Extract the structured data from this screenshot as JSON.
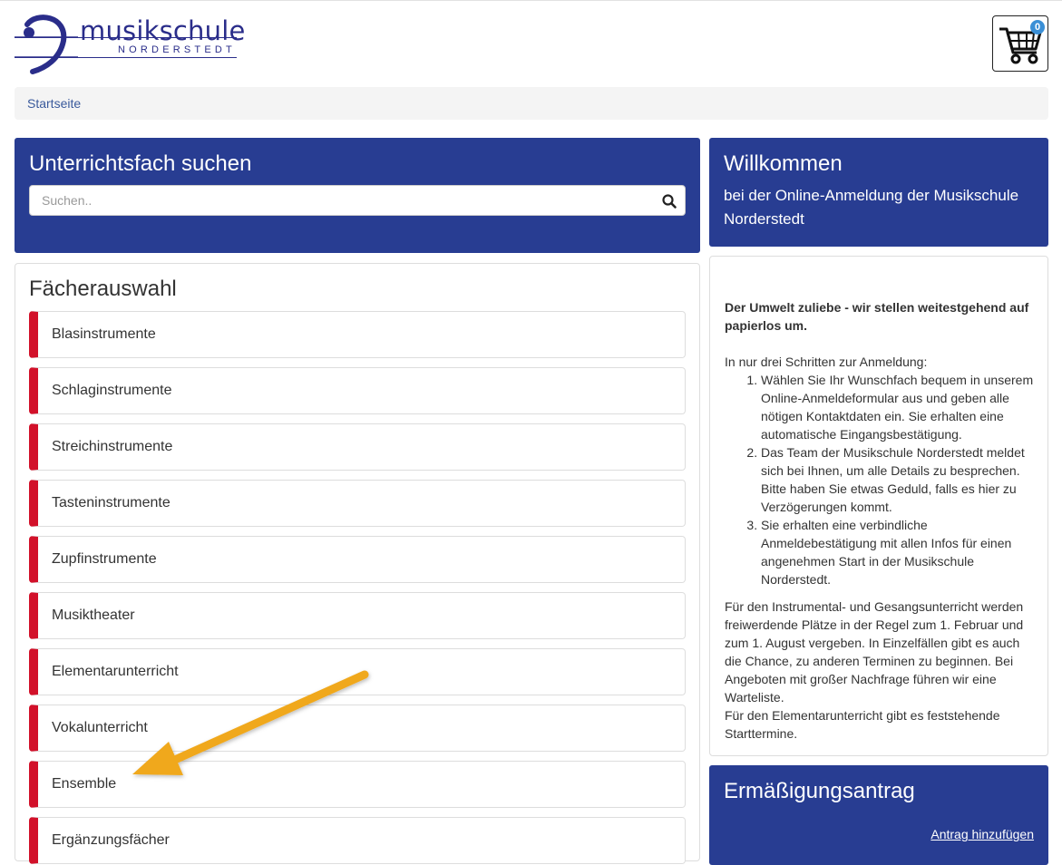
{
  "header": {
    "logo_main": "musikschule",
    "logo_sub": "NORDERSTEDT",
    "cart_count": "0"
  },
  "breadcrumb": {
    "home": "Startseite"
  },
  "search": {
    "title": "Unterrichtsfach suchen",
    "placeholder": "Suchen.."
  },
  "subjects": {
    "title": "Fächerauswahl",
    "items": [
      "Blasinstrumente",
      "Schlaginstrumente",
      "Streichinstrumente",
      "Tasteninstrumente",
      "Zupfinstrumente",
      "Musiktheater",
      "Elementarunterricht",
      "Vokalunterricht",
      "Ensemble",
      "Ergänzungsfächer"
    ]
  },
  "welcome": {
    "title": "Willkommen",
    "subtitle": "bei der Online-Anmeldung der Musikschule Norderstedt"
  },
  "info": {
    "bold_note": "Der Umwelt zuliebe - wir stellen weitestgehend auf papierlos um.",
    "intro": "In nur drei Schritten zur Anmeldung:",
    "steps": [
      "Wählen Sie Ihr Wunschfach bequem in unserem Online-Anmeldeformular aus und geben alle nötigen Kontaktdaten ein. Sie erhalten eine automatische Eingangsbestätigung.",
      "Das Team der Musikschule Norderstedt meldet sich bei Ihnen, um alle Details zu besprechen. Bitte haben Sie etwas Geduld, falls es hier zu Verzögerungen kommt.",
      "Sie erhalten eine verbindliche Anmeldebestätigung mit allen Infos für einen angenehmen Start in der Musikschule Norderstedt."
    ],
    "paragraph": "Für den Instrumental- und Gesangsunterricht werden freiwerdende Plätze in der Regel zum 1. Februar und zum 1. August vergeben. In Einzelfällen gibt es auch die Chance, zu anderen Terminen zu beginnen. Bei Angeboten mit großer Nachfrage führen wir eine Warteliste.",
    "paragraph2": "Für den Elementarunterricht gibt es feststehende Starttermine."
  },
  "discount": {
    "title": "Ermäßigungsantrag",
    "link": "Antrag hinzufügen"
  },
  "colors": {
    "brand_blue": "#283d92",
    "subject_accent": "#d2112a",
    "annotation_arrow": "#f0a81c"
  }
}
